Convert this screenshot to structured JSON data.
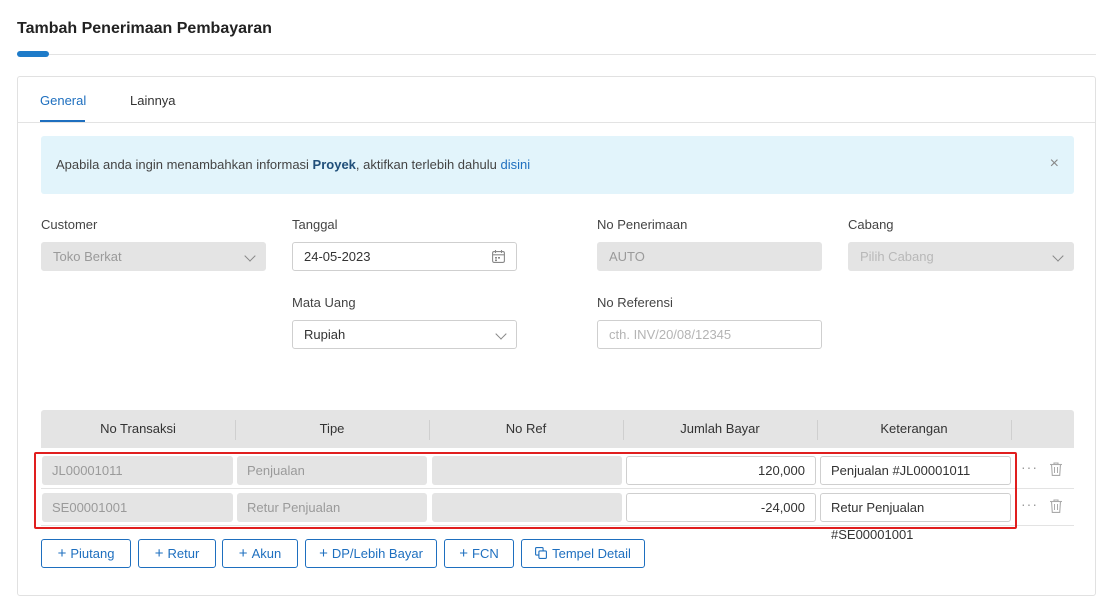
{
  "page": {
    "title": "Tambah Penerimaan Pembayaran"
  },
  "tabs": [
    {
      "label": "General"
    },
    {
      "label": "Lainnya"
    }
  ],
  "info": {
    "text_before": "Apabila anda ingin menambahkan informasi ",
    "text_bold": "Proyek",
    "text_after": ", aktifkan terlebih dahulu ",
    "link": "disini",
    "close": "×"
  },
  "form": {
    "customer": {
      "label": "Customer",
      "value": "Toko Berkat"
    },
    "tanggal": {
      "label": "Tanggal",
      "value": "24-05-2023"
    },
    "no_penerimaan": {
      "label": "No Penerimaan",
      "value": "AUTO"
    },
    "cabang": {
      "label": "Cabang",
      "placeholder": "Pilih Cabang"
    },
    "mata_uang": {
      "label": "Mata Uang",
      "value": "Rupiah"
    },
    "no_referensi": {
      "label": "No Referensi",
      "placeholder": "cth. INV/20/08/12345"
    }
  },
  "table": {
    "headers": [
      "No Transaksi",
      "Tipe",
      "No Ref",
      "Jumlah Bayar",
      "Keterangan"
    ],
    "rows": [
      {
        "no_transaksi": "JL00001011",
        "tipe": "Penjualan",
        "no_ref": "",
        "jumlah_bayar": "120,000",
        "keterangan": "Penjualan #JL00001011"
      },
      {
        "no_transaksi": "SE00001001",
        "tipe": "Retur Penjualan",
        "no_ref": "",
        "jumlah_bayar": "-24,000",
        "keterangan": "Retur Penjualan #SE00001001"
      }
    ]
  },
  "buttons": {
    "piutang": "Piutang",
    "retur": "Retur",
    "akun": "Akun",
    "dp": "DP/Lebih Bayar",
    "fcn": "FCN",
    "tempel": "Tempel Detail"
  },
  "icons": {
    "plus": "+",
    "more": "···"
  },
  "colors": {
    "accent": "#1e6fbf",
    "highlight": "#e01e1e",
    "info_bg": "#e2f4fb"
  }
}
